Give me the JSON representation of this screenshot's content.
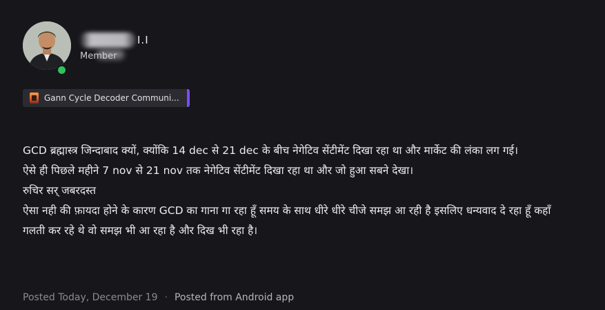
{
  "author": {
    "name_suffix": "I.I",
    "role": "Member",
    "online": true,
    "status_color": "#2fc25b"
  },
  "community": {
    "label": "Gann Cycle Decoder Communi...",
    "accent_color": "#7a4cff"
  },
  "post": {
    "lines": [
      "GCD ब्रह्मास्त्र जिन्दाबाद क्यों, क्योंकि 14 dec से 21 dec के बीच नेगेटिव सेंटीमेंट दिखा रहा था और मार्केट की लंका लग गई।",
      "ऐसे ही पिछले महीने 7 nov से 21 nov तक नेगेटिव सेंटीमेंट दिखा रहा था और जो हुआ सबने देखा।",
      "रुचिर सर् जबरदस्त",
      "ऐसा नही की फ़ायदा होने के कारण GCD का गाना गा रहा हूँ समय के साथ धीरे धीरे चीजे समझ आ रही है इसलिए धन्यवाद दे रहा हूँ कहाँ गलती कर रहे थे वो समझ भी आ रहा है और दिख भी रहा है।"
    ]
  },
  "meta": {
    "posted": "Posted Today, December 19",
    "separator": "·",
    "source": "Posted from Android app"
  }
}
